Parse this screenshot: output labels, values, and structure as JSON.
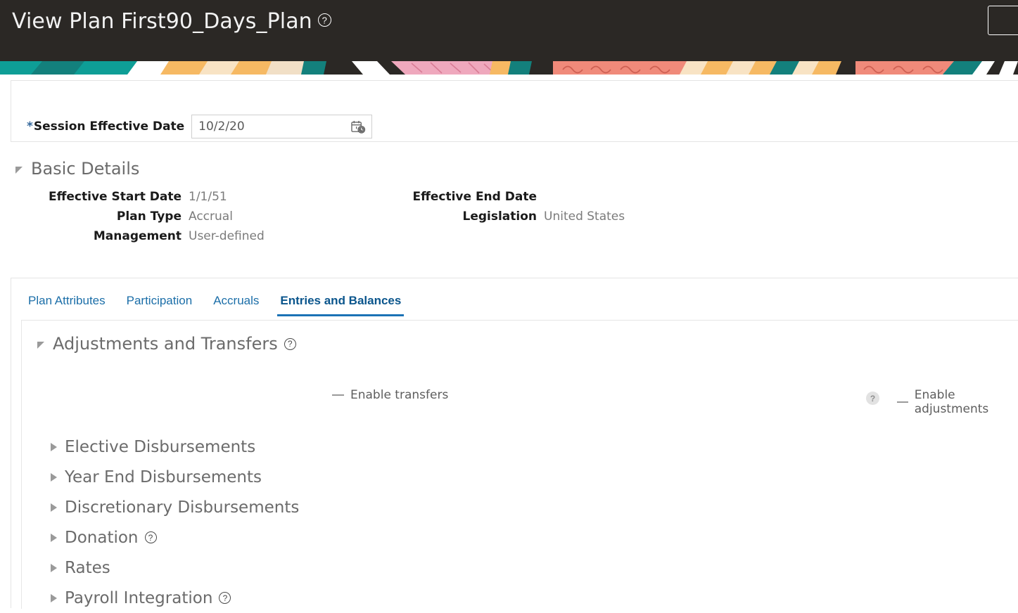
{
  "header": {
    "title": "View Plan First90_Days_Plan",
    "help_icon": "help-circle-icon",
    "action_box": "header-action-button"
  },
  "banner": {
    "colors": [
      "#149a94",
      "#f5b65e",
      "#f7e0bc",
      "#f08a7a",
      "#efa8bd",
      "#c2702a",
      "#ffffff",
      "#2b2825"
    ]
  },
  "session": {
    "label": "Session Effective Date",
    "required_marker": "*",
    "date_value": "10/2/20",
    "date_placeholder": "m/d/yy",
    "calendar_icon": "calendar-clock-icon"
  },
  "basic_details": {
    "title": "Basic Details",
    "left_fields": [
      {
        "label": "Effective Start Date",
        "value": "1/1/51"
      },
      {
        "label": "Plan Type",
        "value": "Accrual"
      },
      {
        "label": "Management",
        "value": "User-defined"
      }
    ],
    "right_fields": [
      {
        "label": "Effective End Date",
        "value": ""
      },
      {
        "label": "Legislation",
        "value": "United States"
      }
    ]
  },
  "tabs": [
    {
      "label": "Plan Attributes",
      "active": false
    },
    {
      "label": "Participation",
      "active": false
    },
    {
      "label": "Accruals",
      "active": false
    },
    {
      "label": "Entries and Balances",
      "active": true
    }
  ],
  "adjustments": {
    "title": "Adjustments and Transfers",
    "help_icon": "help-circle-icon",
    "enable_transfers_label": "Enable transfers",
    "enable_adjustments_label": "Enable adjustments",
    "adjustments_info_icon": "info-help-icon",
    "toggle_state_glyph": "—"
  },
  "collapsed_sections": [
    {
      "label": "Elective Disbursements",
      "has_help": false
    },
    {
      "label": "Year End Disbursements",
      "has_help": false
    },
    {
      "label": "Discretionary Disbursements",
      "has_help": false
    },
    {
      "label": "Donation",
      "has_help": true
    },
    {
      "label": "Rates",
      "has_help": false
    },
    {
      "label": "Payroll Integration",
      "has_help": true
    }
  ],
  "colors": {
    "header_bg": "#2b2825",
    "tab_active": "#0a558c",
    "tab_link": "#1b6ea8",
    "required_star": "#35689c"
  }
}
